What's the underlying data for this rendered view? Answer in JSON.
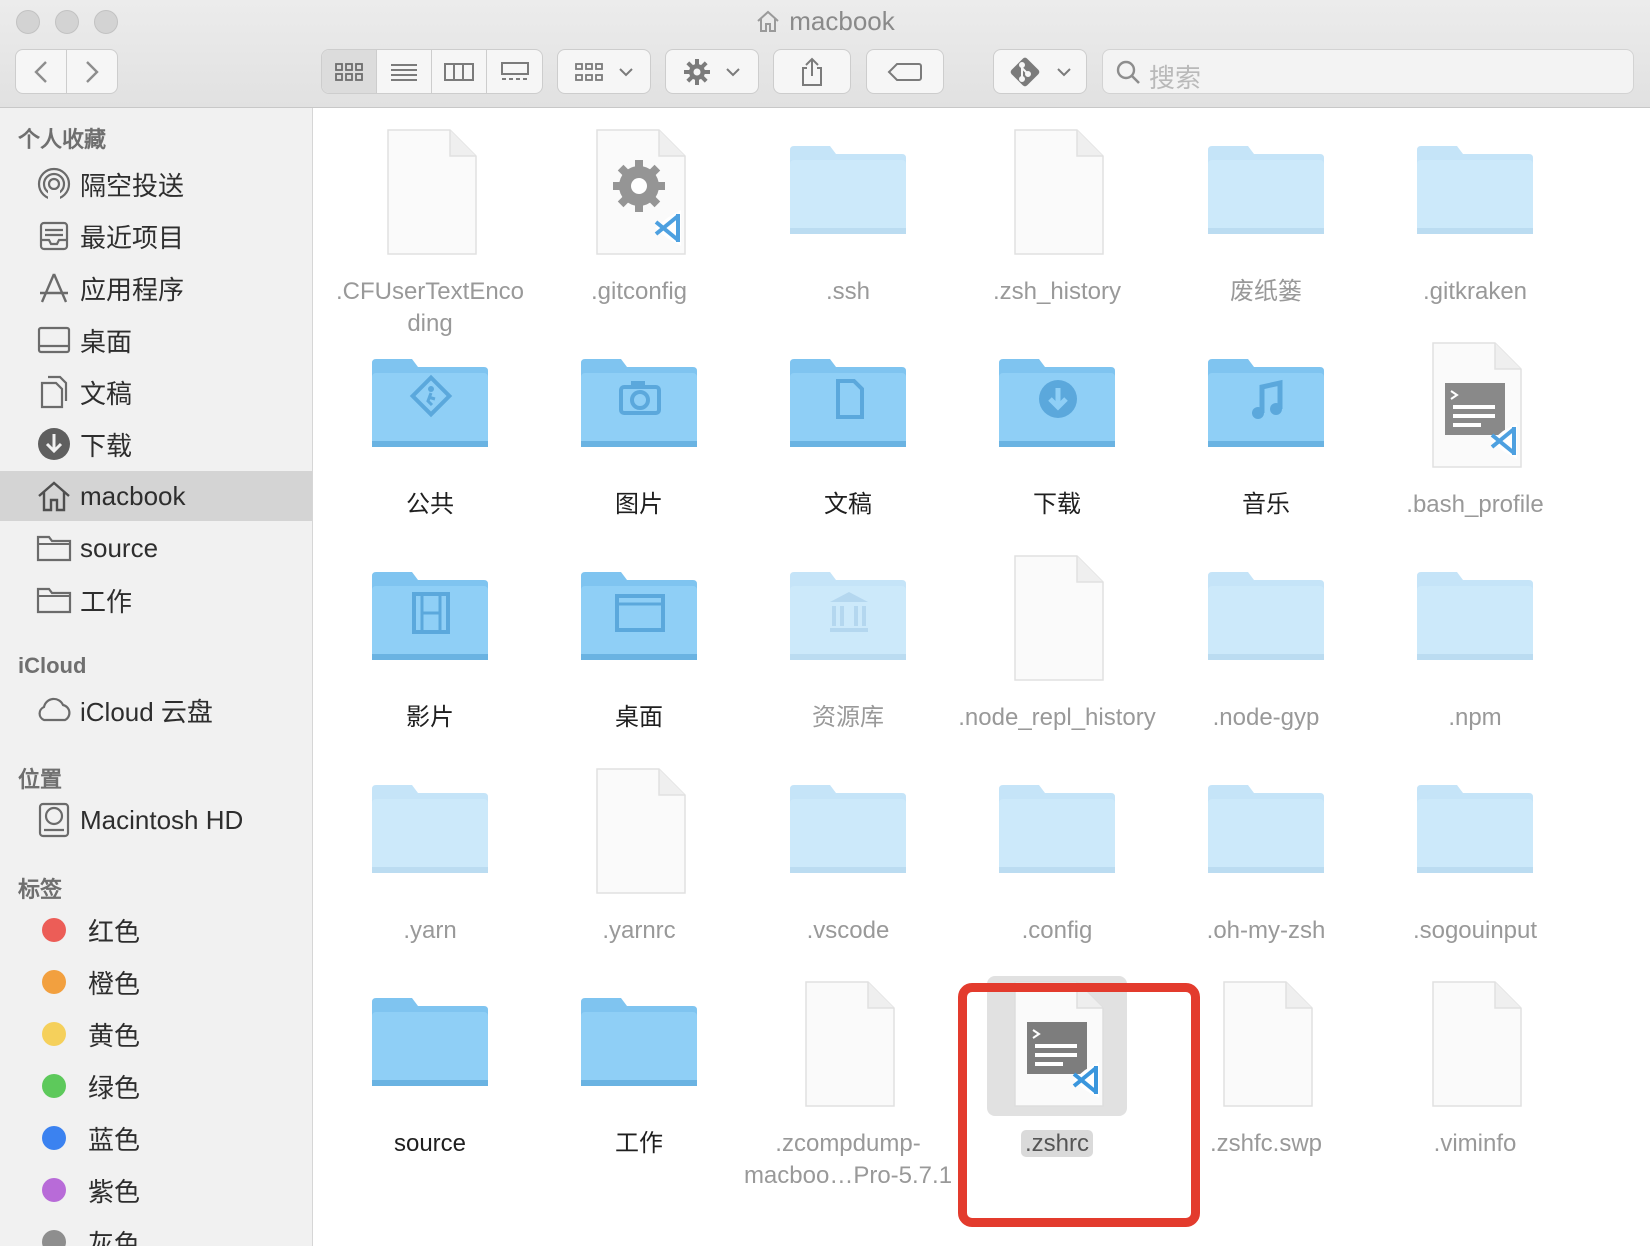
{
  "window": {
    "title": "macbook",
    "search_placeholder": "搜索"
  },
  "toolbar": {
    "back": "back-icon",
    "forward": "forward-icon",
    "views": [
      "icon-view",
      "list-view",
      "column-view",
      "gallery-view"
    ],
    "group": "group-icon",
    "action": "gear-icon",
    "share": "share-icon",
    "tag": "tag-icon",
    "git": "git-icon"
  },
  "sidebar": {
    "favorites_header": "个人收藏",
    "favorites": [
      {
        "label": "隔空投送",
        "icon": "airdrop-icon"
      },
      {
        "label": "最近项目",
        "icon": "recents-icon"
      },
      {
        "label": "应用程序",
        "icon": "applications-icon"
      },
      {
        "label": "桌面",
        "icon": "desktop-icon"
      },
      {
        "label": "文稿",
        "icon": "documents-icon"
      },
      {
        "label": "下载",
        "icon": "downloads-icon"
      },
      {
        "label": "macbook",
        "icon": "home-icon"
      },
      {
        "label": "source",
        "icon": "folder-icon"
      },
      {
        "label": "工作",
        "icon": "folder-icon"
      }
    ],
    "icloud_header": "iCloud",
    "icloud": [
      {
        "label": "iCloud 云盘",
        "icon": "cloud-icon"
      }
    ],
    "locations_header": "位置",
    "locations": [
      {
        "label": "Macintosh HD",
        "icon": "disk-icon"
      }
    ],
    "tags_header": "标签",
    "tags": [
      {
        "label": "红色",
        "color": "#ec5d57"
      },
      {
        "label": "橙色",
        "color": "#f2a03f"
      },
      {
        "label": "黄色",
        "color": "#f5d05b"
      },
      {
        "label": "绿色",
        "color": "#5dc95b"
      },
      {
        "label": "蓝色",
        "color": "#3b82f0"
      },
      {
        "label": "紫色",
        "color": "#b86bd8"
      },
      {
        "label": "灰色",
        "color": "#8e8e8e"
      }
    ]
  },
  "files": [
    {
      "name": ".CFUserTextEnco ding",
      "kind": "doc",
      "dim": true
    },
    {
      "name": ".gitconfig",
      "kind": "gear-doc",
      "dim": true
    },
    {
      "name": ".ssh",
      "kind": "folder",
      "dim": true
    },
    {
      "name": ".zsh_history",
      "kind": "doc",
      "dim": true
    },
    {
      "name": "废纸篓",
      "kind": "folder",
      "dim": true
    },
    {
      "name": ".gitkraken",
      "kind": "folder",
      "dim": true
    },
    {
      "name": "公共",
      "kind": "folder-public",
      "dim": false
    },
    {
      "name": "图片",
      "kind": "folder-pictures",
      "dim": false
    },
    {
      "name": "文稿",
      "kind": "folder-documents",
      "dim": false
    },
    {
      "name": "下载",
      "kind": "folder-downloads",
      "dim": false
    },
    {
      "name": "音乐",
      "kind": "folder-music",
      "dim": false
    },
    {
      "name": ".bash_profile",
      "kind": "vscode-doc",
      "dim": true
    },
    {
      "name": "影片",
      "kind": "folder-movies",
      "dim": false
    },
    {
      "name": "桌面",
      "kind": "folder-desktop",
      "dim": false
    },
    {
      "name": "资源库",
      "kind": "folder-library",
      "dim": true
    },
    {
      "name": ".node_repl_history",
      "kind": "doc",
      "dim": true
    },
    {
      "name": ".node-gyp",
      "kind": "folder",
      "dim": true
    },
    {
      "name": ".npm",
      "kind": "folder",
      "dim": true
    },
    {
      "name": ".yarn",
      "kind": "folder",
      "dim": true
    },
    {
      "name": ".yarnrc",
      "kind": "doc",
      "dim": true
    },
    {
      "name": ".vscode",
      "kind": "folder",
      "dim": true
    },
    {
      "name": ".config",
      "kind": "folder",
      "dim": true
    },
    {
      "name": ".oh-my-zsh",
      "kind": "folder",
      "dim": true
    },
    {
      "name": ".sogouinput",
      "kind": "folder",
      "dim": true
    },
    {
      "name": "source",
      "kind": "folder-plain",
      "dim": false
    },
    {
      "name": "工作",
      "kind": "folder-plain",
      "dim": false
    },
    {
      "name": ".zcompdump- macboo…Pro-5.7.1",
      "kind": "doc",
      "dim": true
    },
    {
      "name": ".zshrc",
      "kind": "vscode-doc",
      "dim": false,
      "selected": true
    },
    {
      "name": ".zshfc.swp",
      "kind": "doc",
      "dim": true
    },
    {
      "name": ".viminfo",
      "kind": "doc",
      "dim": true
    }
  ]
}
